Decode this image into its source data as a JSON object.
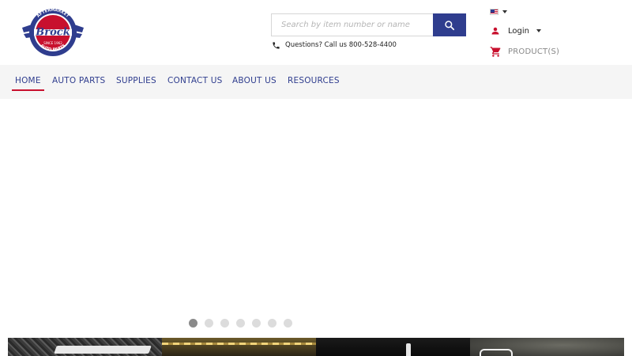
{
  "brand": {
    "logo_text": "Brock",
    "logo_top": "AFTERMARKET",
    "logo_bottom": "AUTO PARTS",
    "logo_since": "SINCE 1962",
    "colors": {
      "primary": "#2f3d8e",
      "accent": "#c8102e"
    }
  },
  "search": {
    "placeholder": "Search by item number or name",
    "value": "",
    "button_icon": "search-icon"
  },
  "contact": {
    "icon": "phone-icon",
    "text": "Questions? Call us 800-528-4400"
  },
  "language": {
    "icon": "us-flag-icon"
  },
  "account": {
    "icon": "user-icon",
    "label": "Login"
  },
  "cart": {
    "icon": "cart-icon",
    "label": "PRODUCT(S)"
  },
  "nav": {
    "items": [
      {
        "label": "HOME",
        "active": true
      },
      {
        "label": "AUTO PARTS",
        "active": false
      },
      {
        "label": "SUPPLIES",
        "active": false
      },
      {
        "label": "CONTACT US",
        "active": false
      },
      {
        "label": "ABOUT US",
        "active": false
      },
      {
        "label": "RESOURCES",
        "active": false
      }
    ]
  },
  "carousel": {
    "slide_count": 7,
    "active_index": 0
  },
  "tiles": [
    {
      "name": "diamond-plate-tile"
    },
    {
      "name": "gold-shelf-tile"
    },
    {
      "name": "dark-bottle-tile"
    },
    {
      "name": "mirror-tile"
    }
  ]
}
